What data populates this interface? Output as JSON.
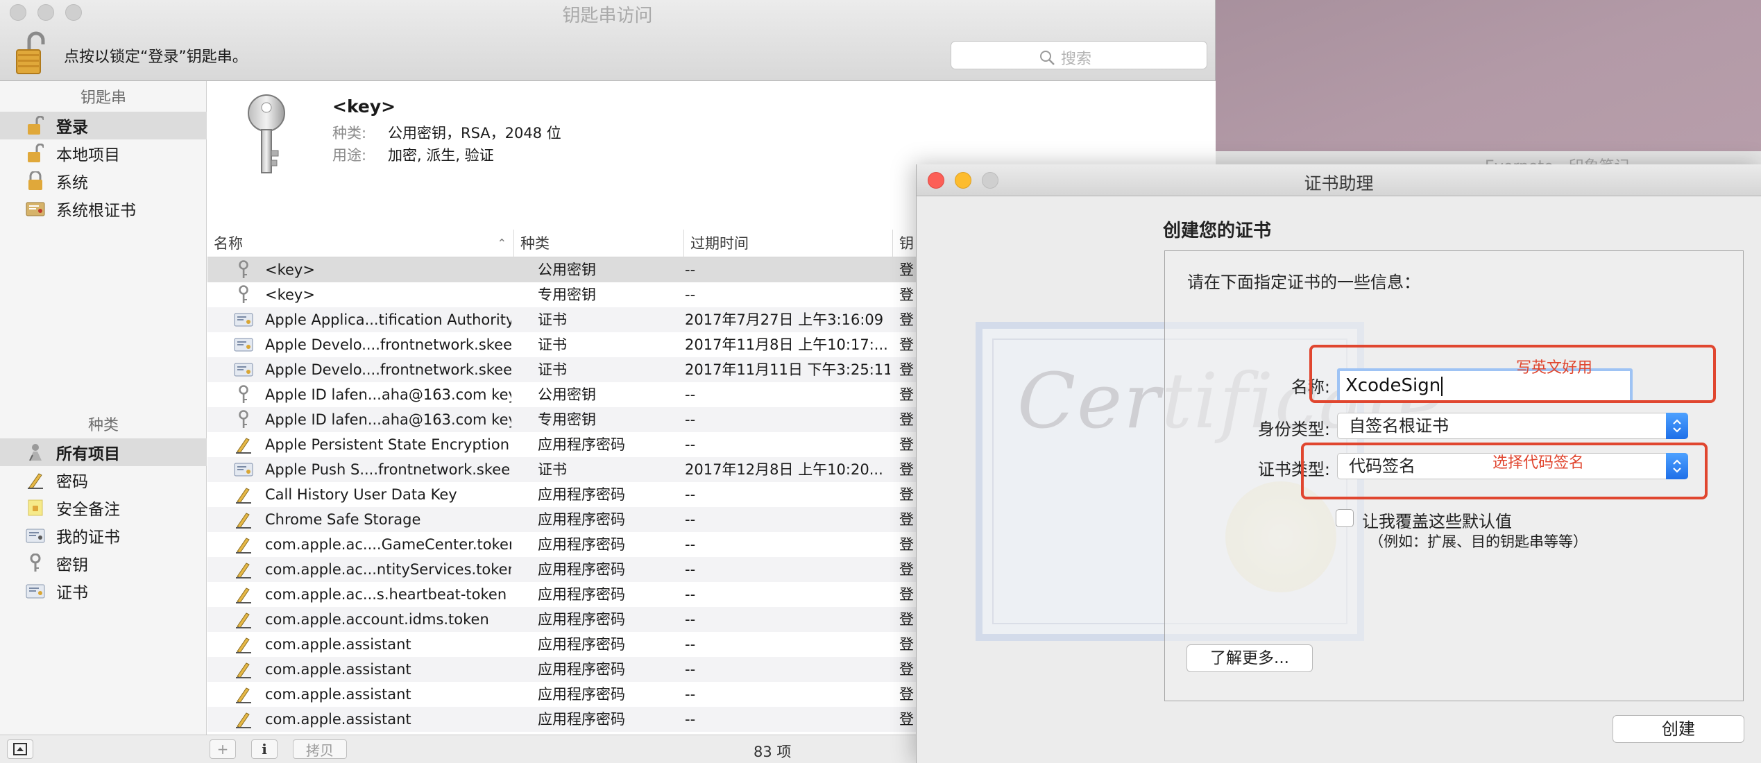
{
  "keychain_window": {
    "title": "钥匙串访问",
    "lock_message": "点按以锁定“登录”钥匙串。",
    "search_placeholder": "搜索",
    "sidebar": {
      "keychains_header": "钥匙串",
      "keychains": [
        {
          "label": "登录",
          "icon": "lock-open-icon",
          "selected": true
        },
        {
          "label": "本地项目",
          "icon": "lock-open-icon",
          "selected": false
        },
        {
          "label": "系统",
          "icon": "lock-icon",
          "selected": false
        },
        {
          "label": "系统根证书",
          "icon": "certificate-folder-icon",
          "selected": false
        }
      ],
      "categories_header": "种类",
      "categories": [
        {
          "label": "所有项目",
          "icon": "all-items-icon",
          "selected": true
        },
        {
          "label": "密码",
          "icon": "password-pen-icon",
          "selected": false
        },
        {
          "label": "安全备注",
          "icon": "secure-note-icon",
          "selected": false
        },
        {
          "label": "我的证书",
          "icon": "my-certificate-icon",
          "selected": false
        },
        {
          "label": "密钥",
          "icon": "key-icon",
          "selected": false
        },
        {
          "label": "证书",
          "icon": "certificate-icon",
          "selected": false
        }
      ]
    },
    "detail": {
      "name": "<key>",
      "kind_label": "种类:",
      "kind_value": "公用密钥，RSA，2048 位",
      "usage_label": "用途:",
      "usage_value": "加密, 派生, 验证"
    },
    "table": {
      "columns": [
        "名称",
        "种类",
        "过期时间",
        "钥"
      ],
      "rows": [
        {
          "icon": "key-icon",
          "name": "<key>",
          "kind": "公用密钥",
          "expires": "--",
          "keychain": "登",
          "selected": true
        },
        {
          "icon": "key-icon",
          "name": "<key>",
          "kind": "专用密钥",
          "expires": "--",
          "keychain": "登"
        },
        {
          "icon": "certificate-icon",
          "name": "Apple Applica...tification Authority",
          "kind": "证书",
          "expires": "2017年7月27日 上午3:16:09",
          "keychain": "登"
        },
        {
          "icon": "certificate-icon",
          "name": "Apple Develo....frontnetwork.skee",
          "kind": "证书",
          "expires": "2017年11月8日 上午10:17:...",
          "keychain": "登"
        },
        {
          "icon": "certificate-icon",
          "name": "Apple Develo....frontnetwork.skee",
          "kind": "证书",
          "expires": "2017年11月11日 下午3:25:11",
          "keychain": "登"
        },
        {
          "icon": "key-icon",
          "name": "Apple ID lafen...aha@163.com key",
          "kind": "公用密钥",
          "expires": "--",
          "keychain": "登"
        },
        {
          "icon": "key-icon",
          "name": "Apple ID lafen...aha@163.com key",
          "kind": "专用密钥",
          "expires": "--",
          "keychain": "登"
        },
        {
          "icon": "password-pen-icon",
          "name": "Apple Persistent State Encryption",
          "kind": "应用程序密码",
          "expires": "--",
          "keychain": "登"
        },
        {
          "icon": "certificate-icon",
          "name": "Apple Push S....frontnetwork.skee",
          "kind": "证书",
          "expires": "2017年12月8日 上午10:20...",
          "keychain": "登"
        },
        {
          "icon": "password-pen-icon",
          "name": "Call History User Data Key",
          "kind": "应用程序密码",
          "expires": "--",
          "keychain": "登"
        },
        {
          "icon": "password-pen-icon",
          "name": "Chrome Safe Storage",
          "kind": "应用程序密码",
          "expires": "--",
          "keychain": "登"
        },
        {
          "icon": "password-pen-icon",
          "name": "com.apple.ac....GameCenter.token",
          "kind": "应用程序密码",
          "expires": "--",
          "keychain": "登"
        },
        {
          "icon": "password-pen-icon",
          "name": "com.apple.ac...ntityServices.token",
          "kind": "应用程序密码",
          "expires": "--",
          "keychain": "登"
        },
        {
          "icon": "password-pen-icon",
          "name": "com.apple.ac...s.heartbeat-token",
          "kind": "应用程序密码",
          "expires": "--",
          "keychain": "登"
        },
        {
          "icon": "password-pen-icon",
          "name": "com.apple.account.idms.token",
          "kind": "应用程序密码",
          "expires": "--",
          "keychain": "登"
        },
        {
          "icon": "password-pen-icon",
          "name": "com.apple.assistant",
          "kind": "应用程序密码",
          "expires": "--",
          "keychain": "登"
        },
        {
          "icon": "password-pen-icon",
          "name": "com.apple.assistant",
          "kind": "应用程序密码",
          "expires": "--",
          "keychain": "登"
        },
        {
          "icon": "password-pen-icon",
          "name": "com.apple.assistant",
          "kind": "应用程序密码",
          "expires": "--",
          "keychain": "登"
        },
        {
          "icon": "password-pen-icon",
          "name": "com.apple.assistant",
          "kind": "应用程序密码",
          "expires": "--",
          "keychain": "登"
        }
      ]
    },
    "bottom_bar": {
      "add_symbol": "+",
      "info_symbol": "i",
      "copy_label": "拷贝",
      "count": "83 项"
    }
  },
  "behind_window_text": "Evernote - 印象笔记",
  "certificate_assistant": {
    "title": "证书助理",
    "heading": "创建您的证书",
    "intro": "请在下面指定证书的一些信息：",
    "art_word": "Certificate",
    "name_label": "名称:",
    "name_value": "XcodeSign",
    "identity_type_label": "身份类型:",
    "identity_type_value": "自签名根证书",
    "cert_type_label": "证书类型:",
    "cert_type_value": "代码签名",
    "override_label": "让我覆盖这些默认值",
    "override_hint": "（例如：扩展、目的钥匙串等等）",
    "learn_more": "了解更多...",
    "create": "创建",
    "annotations": {
      "name_note": "写英文好用",
      "type_note": "选择代码签名"
    }
  },
  "colors": {
    "annotation_red": "#e0462f",
    "traffic_red": "#fc5f57",
    "traffic_yellow": "#fdbc2e",
    "stepper_blue": "#1e6fe8",
    "focus_ring": "#9ec3f4"
  }
}
